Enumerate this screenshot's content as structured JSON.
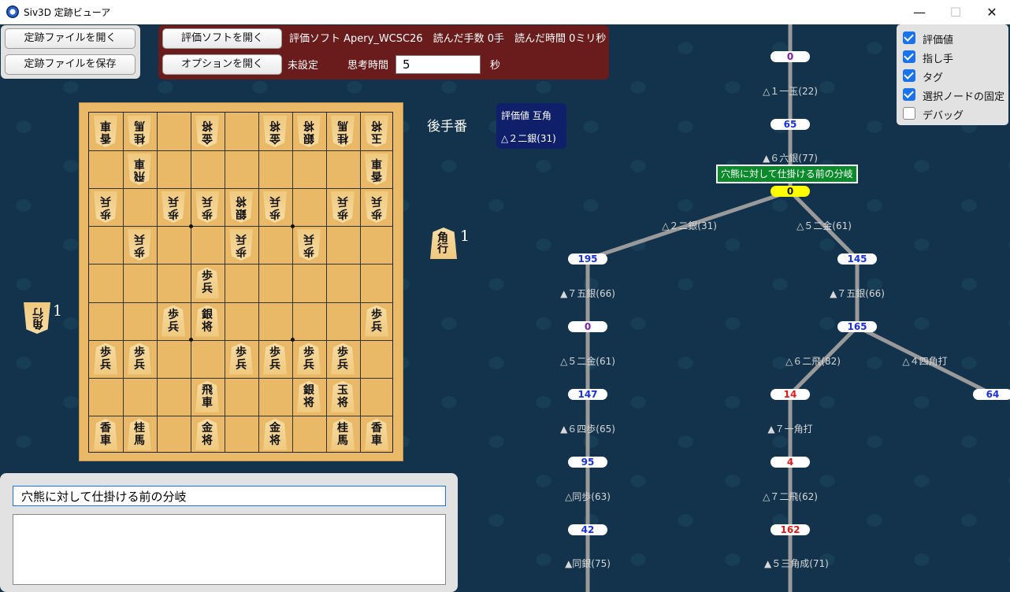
{
  "window": {
    "title": "Siv3D 定跡ビューア",
    "minimize": "—",
    "maximize": "☐",
    "close": "✕"
  },
  "file_buttons": {
    "open": "定跡ファイルを開く",
    "save": "定跡ファイルを保存"
  },
  "engine": {
    "open_button": "評価ソフトを開く",
    "options_button": "オプションを開く",
    "info": "評価ソフト Apery_WCSC26　読んだ手数 0手　読んだ時間 0ミリ秒",
    "status": "未設定",
    "think_label": "思考時間",
    "think_value": "5",
    "unit": "秒"
  },
  "turn_label": "後手番",
  "eval_box": {
    "line1": "評価値 互角",
    "line2": "△２二銀(31)"
  },
  "hands": {
    "gote": {
      "piece": "角行",
      "count": "1"
    },
    "sente": {
      "piece": "角行",
      "count": "1"
    }
  },
  "board": [
    [
      {
        "t": "香車",
        "s": "g"
      },
      {
        "t": "桂馬",
        "s": "g"
      },
      null,
      {
        "t": "金将",
        "s": "g"
      },
      null,
      {
        "t": "金将",
        "s": "g"
      },
      {
        "t": "銀将",
        "s": "g"
      },
      {
        "t": "桂馬",
        "s": "g"
      },
      {
        "t": "玉将",
        "s": "g"
      }
    ],
    [
      null,
      {
        "t": "飛車",
        "s": "g"
      },
      null,
      null,
      null,
      null,
      null,
      null,
      {
        "t": "香車",
        "s": "g"
      }
    ],
    [
      {
        "t": "歩兵",
        "s": "g"
      },
      null,
      {
        "t": "歩兵",
        "s": "g"
      },
      {
        "t": "歩兵",
        "s": "g"
      },
      {
        "t": "銀将",
        "s": "g"
      },
      {
        "t": "歩兵",
        "s": "g"
      },
      null,
      {
        "t": "歩兵",
        "s": "g"
      },
      {
        "t": "歩兵",
        "s": "g"
      }
    ],
    [
      null,
      {
        "t": "歩兵",
        "s": "g"
      },
      null,
      null,
      {
        "t": "歩兵",
        "s": "g"
      },
      null,
      {
        "t": "歩兵",
        "s": "g"
      },
      null,
      null
    ],
    [
      null,
      null,
      null,
      {
        "t": "歩兵",
        "s": "s"
      },
      null,
      null,
      null,
      null,
      null
    ],
    [
      null,
      null,
      {
        "t": "歩兵",
        "s": "s"
      },
      {
        "t": "銀将",
        "s": "s"
      },
      null,
      null,
      null,
      null,
      {
        "t": "歩兵",
        "s": "s"
      }
    ],
    [
      {
        "t": "歩兵",
        "s": "s"
      },
      {
        "t": "歩兵",
        "s": "s"
      },
      null,
      null,
      {
        "t": "歩兵",
        "s": "s"
      },
      {
        "t": "歩兵",
        "s": "s"
      },
      {
        "t": "歩兵",
        "s": "s"
      },
      {
        "t": "歩兵",
        "s": "s"
      },
      null
    ],
    [
      null,
      null,
      null,
      {
        "t": "飛車",
        "s": "s"
      },
      null,
      null,
      {
        "t": "銀将",
        "s": "s"
      },
      {
        "t": "玉将",
        "s": "s"
      },
      null
    ],
    [
      {
        "t": "香車",
        "s": "s"
      },
      {
        "t": "桂馬",
        "s": "s"
      },
      null,
      {
        "t": "金将",
        "s": "s"
      },
      null,
      {
        "t": "金将",
        "s": "s"
      },
      null,
      {
        "t": "桂馬",
        "s": "s"
      },
      {
        "t": "香車",
        "s": "s"
      }
    ]
  ],
  "comment": {
    "title_value": "穴熊に対して仕掛ける前の分岐",
    "body_value": ""
  },
  "checkboxes": [
    {
      "label": "評価値",
      "checked": true
    },
    {
      "label": "指し手",
      "checked": true
    },
    {
      "label": "タグ",
      "checked": true
    },
    {
      "label": "選択ノードの固定",
      "checked": true
    },
    {
      "label": "デバッグ",
      "checked": false
    }
  ],
  "tree": {
    "tag": "穴熊に対して仕掛ける前の分岐",
    "nodes": [
      {
        "v": "0",
        "c": "#7a1fa2"
      },
      {
        "v": "65",
        "c": "#1a2fe0"
      },
      {
        "v": "0",
        "c": "#111"
      },
      {
        "v": "195",
        "c": "#1a2fe0"
      },
      {
        "v": "145",
        "c": "#1a2fe0"
      },
      {
        "v": "0",
        "c": "#7a1fa2"
      },
      {
        "v": "165",
        "c": "#1a2fe0"
      },
      {
        "v": "147",
        "c": "#1a2fe0"
      },
      {
        "v": "14",
        "c": "#e01a1a"
      },
      {
        "v": "64",
        "c": "#1a2fe0"
      },
      {
        "v": "95",
        "c": "#1a2fe0"
      },
      {
        "v": "4",
        "c": "#e01a1a"
      },
      {
        "v": "42",
        "c": "#1a2fe0"
      },
      {
        "v": "162",
        "c": "#e01a1a"
      }
    ],
    "moves": [
      "△１一玉(22)",
      "▲６六銀(77)",
      "△２二銀(31)",
      "△５二金(61)",
      "▲７五銀(66)",
      "▲７五銀(66)",
      "△５二金(61)",
      "△６二飛(82)",
      "△４四角打",
      "▲６四歩(65)",
      "▲７一角打",
      "△同歩(63)",
      "△７二飛(62)",
      "▲同銀(75)",
      "▲５三角成(71)"
    ]
  }
}
